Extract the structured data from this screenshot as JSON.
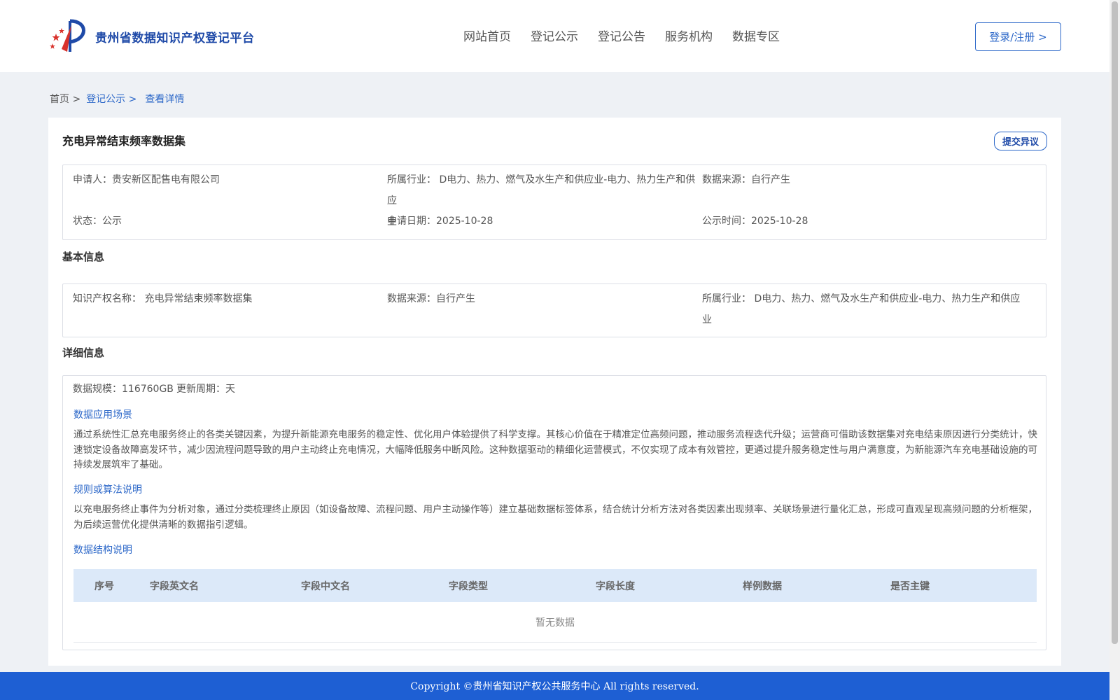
{
  "header": {
    "site_name": "贵州省数据知识产权登记平台",
    "nav": [
      "网站首页",
      "登记公示",
      "登记公告",
      "服务机构",
      "数据专区"
    ],
    "login_label": "登录/注册 >"
  },
  "breadcrumb": {
    "home": "首页 >",
    "section": "登记公示 >",
    "current": "查看详情"
  },
  "detail": {
    "title": "充电异常结束频率数据集",
    "objection_label": "提交异议",
    "summary": {
      "applicant_label": "申请人：",
      "applicant": "贵安新区配售电有限公司",
      "industry_label": "所属行业：",
      "industry_line1": "D电力、热力、燃气及水生产和供应业-电力、热力生产和供应",
      "industry_line2": "业",
      "source_label": "数据来源：",
      "source": "自行产生",
      "status_label": "状态：",
      "status": "公示",
      "apply_date_label": "申请日期：",
      "apply_date": "2025-10-28",
      "publish_date_label": "公示时间：",
      "publish_date": "2025-10-28"
    },
    "basic": {
      "section_title": "基本信息",
      "name_label": "知识产权名称：",
      "name": "充电异常结束频率数据集",
      "source_label": "数据来源：",
      "source": "自行产生",
      "industry_label": "所属行业：",
      "industry_line1": "D电力、热力、燃气及水生产和供应业-电力、热力生产和供应",
      "industry_line2": "业"
    },
    "details": {
      "section_title": "详细信息",
      "scale_label": "数据规模：",
      "scale": "116760GB",
      "cycle_label": "更新周期：",
      "cycle": "天",
      "scenario_title": "数据应用场景",
      "scenario_text": "通过系统性汇总充电服务终止的各类关键因素，为提升新能源充电服务的稳定性、优化用户体验提供了科学支撑。其核心价值在于精准定位高频问题，推动服务流程迭代升级；运营商可借助该数据集对充电结束原因进行分类统计，快速锁定设备故障高发环节，减少因流程问题导致的用户主动终止充电情况，大幅降低服务中断风险。这种数据驱动的精细化运营模式，不仅实现了成本有效管控，更通过提升服务稳定性与用户满意度，为新能源汽车充电基础设施的可持续发展筑牢了基础。",
      "rules_title": "规则或算法说明",
      "rules_text": "以充电服务终止事件为分析对象，通过分类梳理终止原因（如设备故障、流程问题、用户主动操作等）建立基础数据标签体系，结合统计分析方法对各类因素出现频率、关联场景进行量化汇总，形成可直观呈现高频问题的分析框架，为后续运营优化提供清晰的数据指引逻辑。",
      "structure_title": "数据结构说明",
      "table_headers": [
        "序号",
        "字段英文名",
        "字段中文名",
        "字段类型",
        "字段长度",
        "样例数据",
        "是否主键"
      ],
      "empty_text": "暂无数据"
    }
  },
  "footer": {
    "copyright": "Copyright ©贵州省知识产权公共服务中心 All rights reserved."
  }
}
